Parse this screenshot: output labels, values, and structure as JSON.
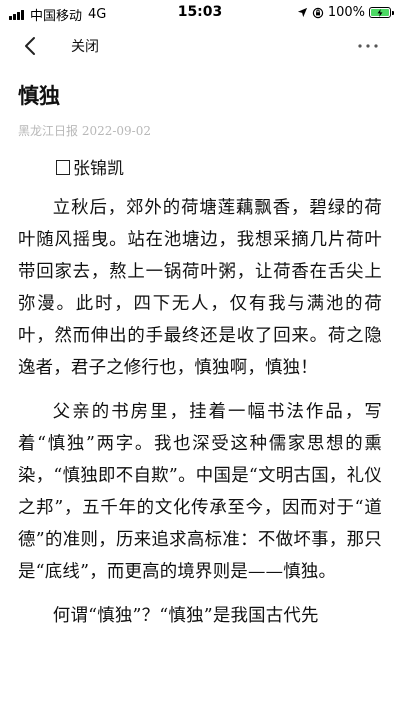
{
  "status_bar": {
    "carrier": "中国移动",
    "network": "4G",
    "time": "15:03",
    "battery": "100%",
    "battery_color": "#4cd964"
  },
  "nav": {
    "back_icon": "chevron-left-icon",
    "close_label": "关闭",
    "more_icon": "more-dots-icon"
  },
  "article": {
    "title": "慎独",
    "meta": "黑龙江日报 2022-09-02",
    "author": "张锦凯",
    "paragraphs": [
      "立秋后，郊外的荷塘莲藕飘香，碧绿的荷叶随风摇曳。站在池塘边，我想采摘几片荷叶带回家去，熬上一锅荷叶粥，让荷香在舌尖上弥漫。此时，四下无人，仅有我与满池的荷叶，然而伸出的手最终还是收了回来。荷之隐逸者，君子之修行也，慎独啊，慎独！",
      "父亲的书房里，挂着一幅书法作品，写着“慎独”两字。我也深受这种儒家思想的熏染，“慎独即不自欺”。中国是“文明古国，礼仪之邦”，五千年的文化传承至今，因而对于“道德”的准则，历来追求高标准：不做坏事，那只是“底线”，而更高的境界则是——慎独。",
      "何谓“慎独”？“慎独”是我国古代先"
    ]
  }
}
